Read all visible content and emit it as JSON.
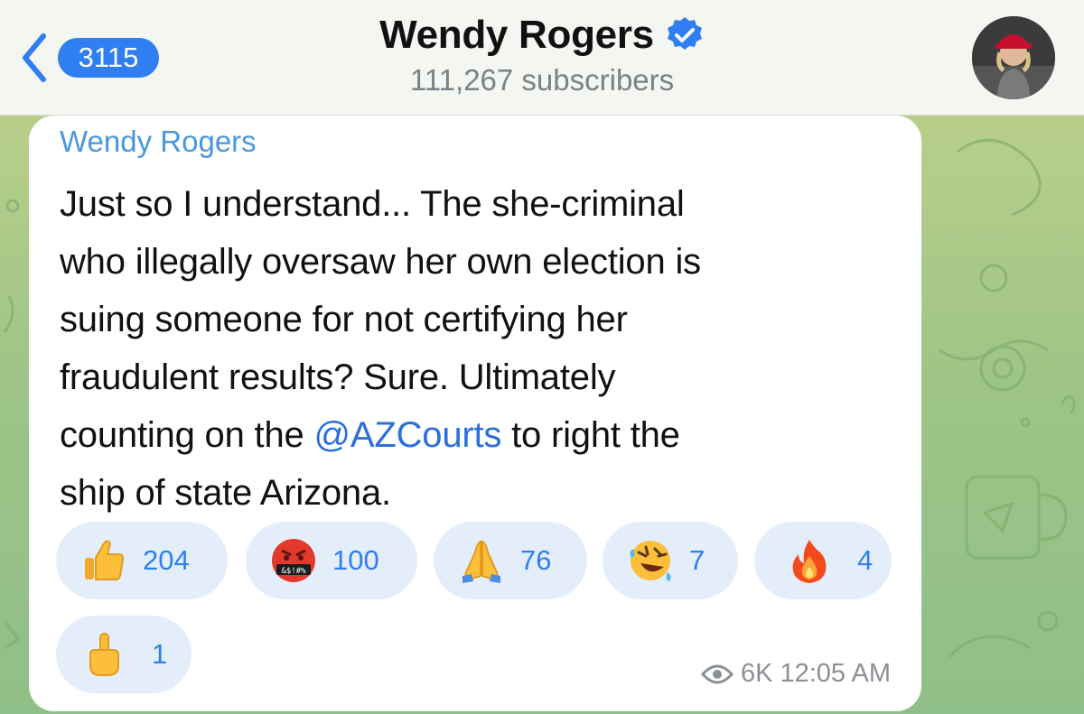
{
  "header": {
    "back_badge": "3115",
    "channel_name": "Wendy Rogers",
    "subscribers": "111,267 subscribers"
  },
  "message": {
    "sender": "Wendy Rogers",
    "text_lines": [
      "Just so I understand... The she-criminal",
      "who illegally oversaw her own election is",
      "suing someone for not certifying her",
      "fraudulent results? Sure. Ultimately",
      "counting on the ",
      "to right the",
      "ship of state Arizona."
    ],
    "mention": "@AZCourts",
    "views": "6K",
    "time": "12:05 AM"
  },
  "reactions": [
    {
      "icon": "thumbs-up-icon",
      "count": "204"
    },
    {
      "icon": "cursing-face-icon",
      "count": "100"
    },
    {
      "icon": "folded-hands-icon",
      "count": "76"
    },
    {
      "icon": "rofl-face-icon",
      "count": "7"
    },
    {
      "icon": "fire-icon",
      "count": "4"
    },
    {
      "icon": "middle-finger-icon",
      "count": "1"
    }
  ],
  "colors": {
    "accent": "#2f7ef2",
    "sender": "#4a97e0",
    "reaction_bg": "#e4eefa",
    "wallpaper": "#9ec487"
  }
}
